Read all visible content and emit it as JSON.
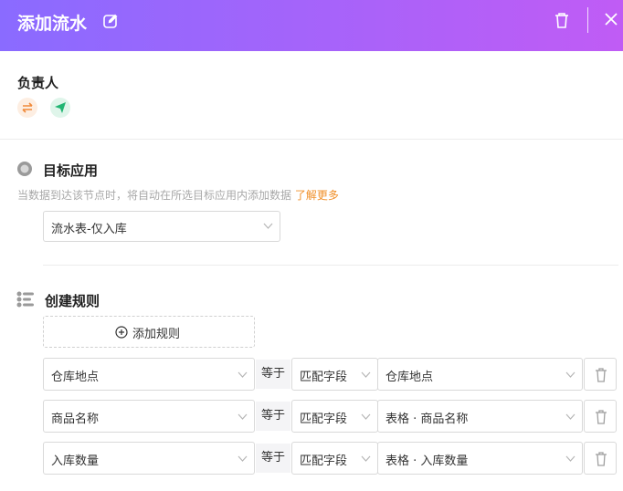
{
  "header": {
    "title": "添加流水"
  },
  "owner": {
    "label": "负责人"
  },
  "target_app": {
    "label": "目标应用",
    "description": "当数据到达该节点时，将自动在所选目标应用内添加数据",
    "learn_more": "了解更多",
    "selected": "流水表-仅入库"
  },
  "rules": {
    "label": "创建规则",
    "add_label": "添加规则",
    "operator": "等于",
    "items": [
      {
        "field": "仓库地点",
        "mode": "匹配字段",
        "value": "仓库地点"
      },
      {
        "field": "商品名称",
        "mode": "匹配字段",
        "value": "表格 · 商品名称"
      },
      {
        "field": "入库数量",
        "mode": "匹配字段",
        "value": "表格 · 入库数量"
      }
    ]
  },
  "colors": {
    "header_start": "#8a6bff",
    "header_end": "#c05cf5",
    "link": "#f0902a"
  },
  "icons": [
    "edit-icon",
    "trash-icon",
    "close-icon",
    "swap-icon",
    "send-icon",
    "target-app-icon",
    "rules-icon",
    "plus-circle-icon",
    "chevron-down-icon"
  ]
}
